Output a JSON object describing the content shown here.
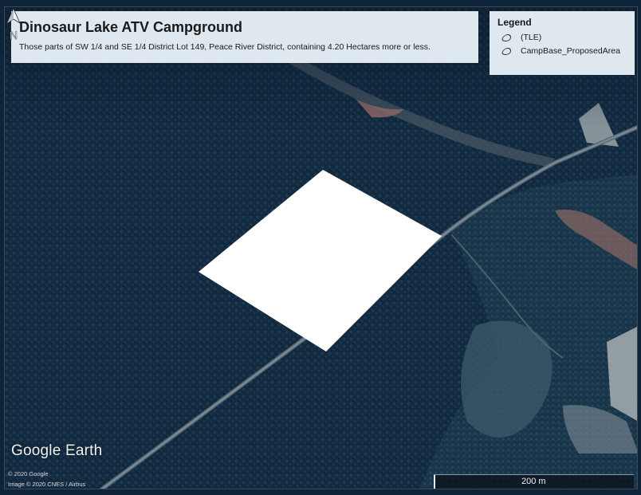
{
  "map": {
    "title": "Dinosaur Lake ATV Campground",
    "subtitle": "Those parts of SW 1/4 and SE 1/4 District Lot 149, Peace River District, containing 4.20 Hectares more or less.",
    "legend": {
      "title": "Legend",
      "items": [
        {
          "label": "(TLE)"
        },
        {
          "label": "CampBase_ProposedArea"
        }
      ]
    },
    "attribution": {
      "logo": "Google Earth",
      "copyright": "© 2020 Google",
      "imagery": "Image © 2020 CNES / Airbus"
    },
    "scale": {
      "label": "200 m"
    },
    "north_arrow": {
      "letter": "N"
    },
    "colors": {
      "forest": "#11283d",
      "forest_light": "#1c3b54",
      "road": "#6b7c86",
      "proposed_area": "#ffffff",
      "clearing": "#7d6e6a"
    }
  }
}
